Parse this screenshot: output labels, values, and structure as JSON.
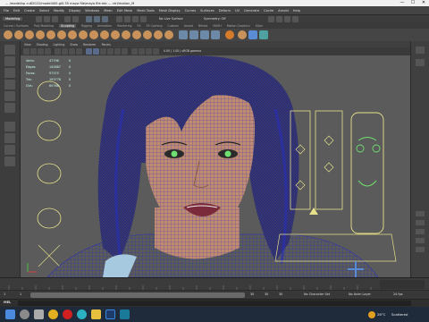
{
  "window": {
    "title": "... /model/sp cu82022/model400-gl0.35 maya file\\maya file.mb --- ctrl/motion_M",
    "minimize": "—",
    "maximize": "☐",
    "close": "✕"
  },
  "menubar": [
    "File",
    "Edit",
    "Create",
    "Select",
    "Modify",
    "Display",
    "Windows",
    "Mesh",
    "Edit Mesh",
    "Mesh Tools",
    "Mesh Display",
    "Curves",
    "Surfaces",
    "Deform",
    "UV",
    "Generate",
    "Cache",
    "Arnold",
    "Help"
  ],
  "statusline": {
    "mode": "Modeling",
    "symmetry_label": "No Live Surface",
    "symmetry_value": "Symmetry: Off"
  },
  "shelf_tabs": [
    "Curves / Surfaces",
    "Poly Modeling",
    "Sculpting",
    "Rigging",
    "Animation",
    "Rendering",
    "FX",
    "FX Caching",
    "Custom",
    "Arnold",
    "Bifrost",
    "MASH",
    "Motion Graphics",
    "XGen"
  ],
  "active_shelf_tab": "Sculpting",
  "viewport_menu": [
    "View",
    "Shading",
    "Lighting",
    "Show",
    "Renderer",
    "Panels"
  ],
  "viewport_toolbar_readout": "0.00 | 1.00 | sRGB gamma",
  "hud": {
    "rows": [
      {
        "label": "Verts:",
        "v1": "47796",
        "v2": "0"
      },
      {
        "label": "Edges:",
        "v1": "142687",
        "v2": "0"
      },
      {
        "label": "Faces:",
        "v1": "97375",
        "v2": "0"
      },
      {
        "label": "Tris:",
        "v1": "193778",
        "v2": "0"
      },
      {
        "label": "UVs:",
        "v1": "60768",
        "v2": "0"
      }
    ]
  },
  "rangebar": {
    "start": "1",
    "inner_start": "1",
    "inner_end": "30",
    "end": "30",
    "end2": "30",
    "character_set": "No Character Set",
    "anim_layer": "No Anim Layer",
    "fps": "24 fps"
  },
  "cmdline": {
    "lang": "MEL"
  },
  "taskbar": {
    "temperature": "26°C",
    "weather": "Scattered",
    "time": "",
    "icons": [
      "windows-start",
      "search",
      "task-view",
      "chrome",
      "opera",
      "edge",
      "file-explorer",
      "photoshop",
      "maya"
    ]
  },
  "colors": {
    "wire": "#2a2fb0",
    "skin": "#c08b70",
    "hair": "#3a3a6a",
    "face_ui_lines": "#e6e08a",
    "accent_green": "#6fe06f"
  }
}
